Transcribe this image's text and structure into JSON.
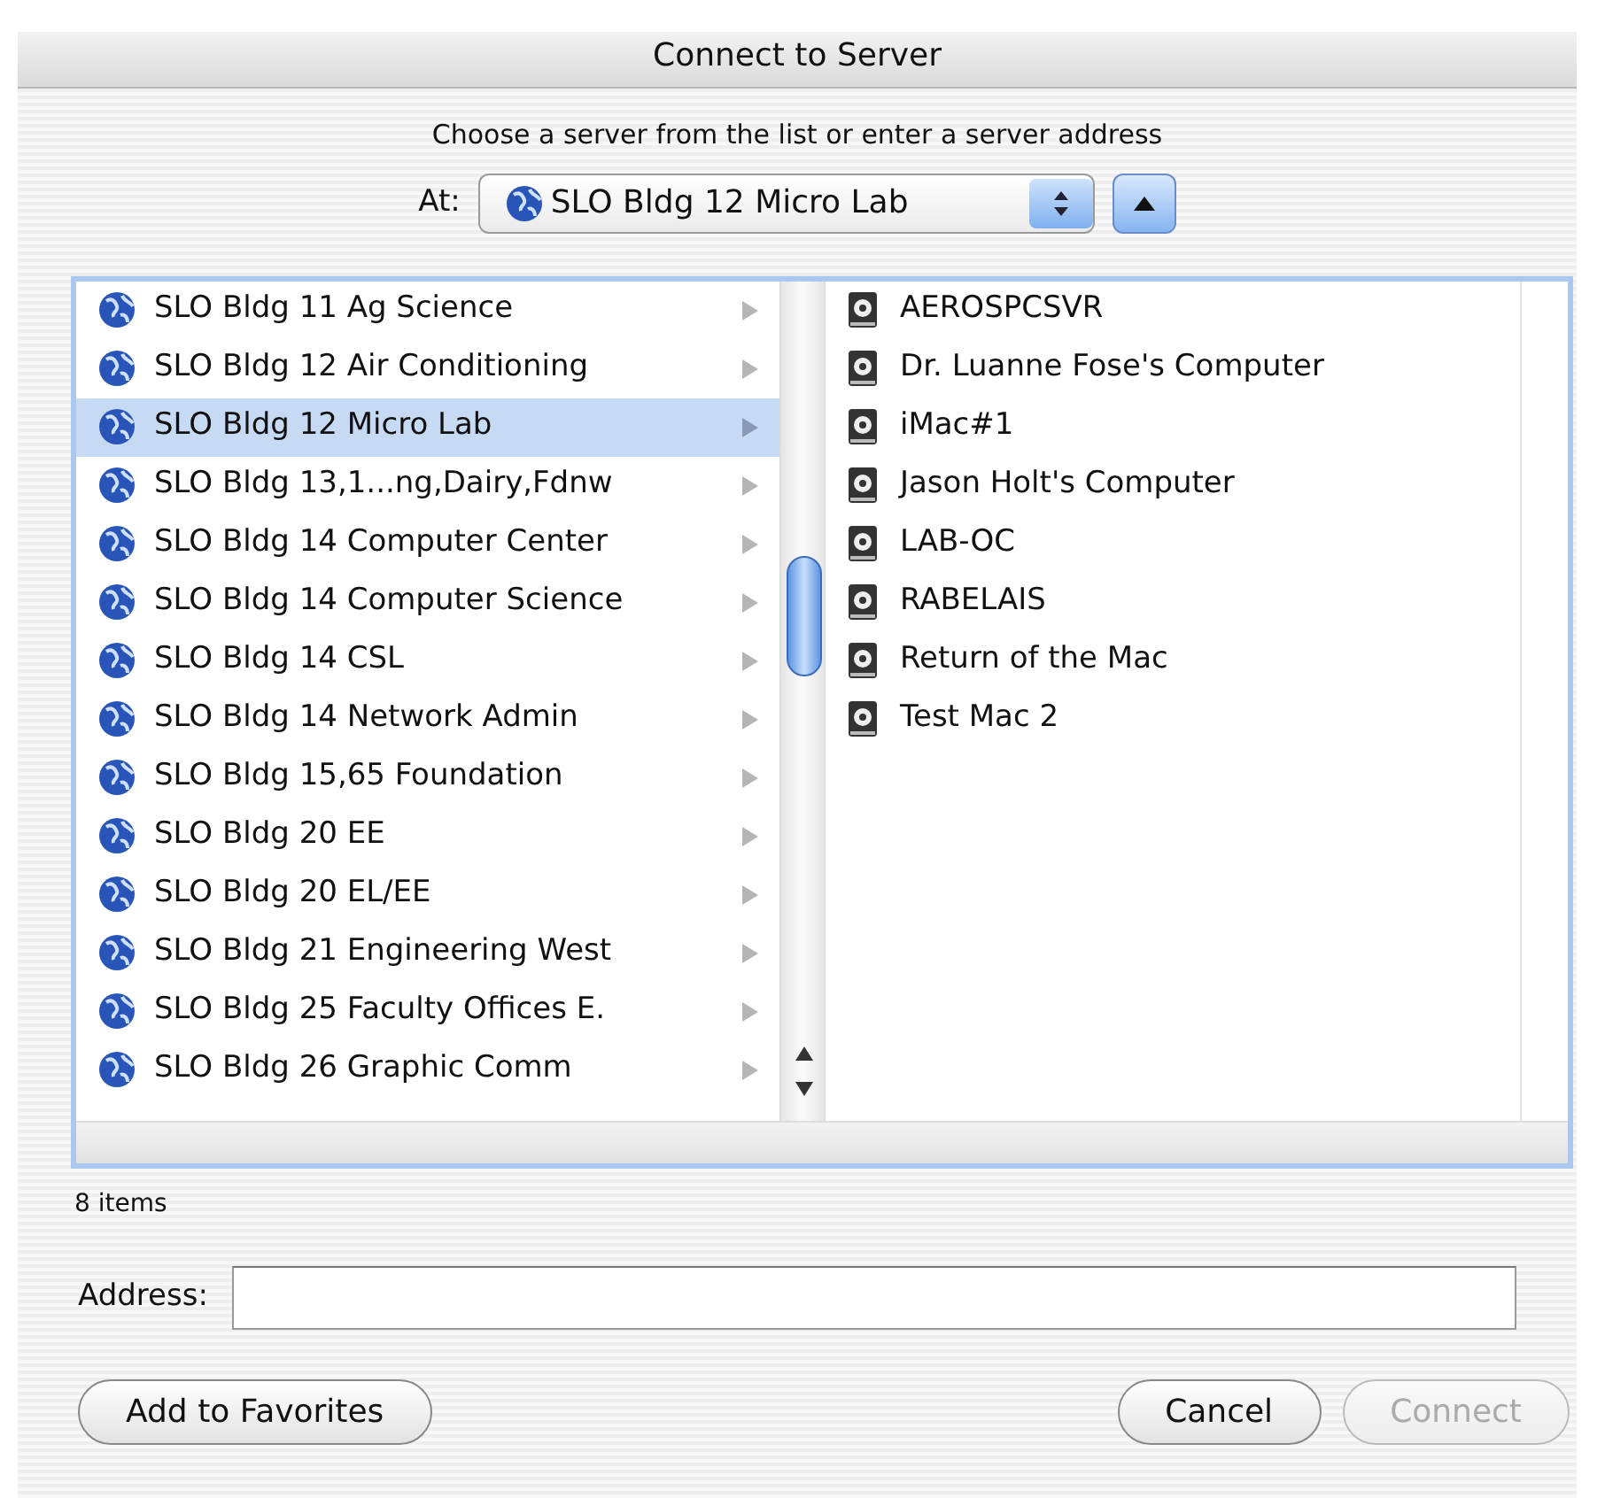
{
  "window": {
    "title": "Connect to Server"
  },
  "prompt": "Choose a server from the list or enter a server address",
  "at": {
    "label": "At:",
    "value": "SLO Bldg 12 Micro Lab"
  },
  "servers": [
    {
      "name": "SLO Bldg 11 Ag Science",
      "selected": false
    },
    {
      "name": "SLO Bldg 12 Air Conditioning",
      "selected": false
    },
    {
      "name": "SLO Bldg 12 Micro Lab",
      "selected": true
    },
    {
      "name": "SLO Bldg 13,1...ng,Dairy,Fdnw",
      "selected": false
    },
    {
      "name": "SLO Bldg 14 Computer Center",
      "selected": false
    },
    {
      "name": "SLO Bldg 14 Computer Science",
      "selected": false
    },
    {
      "name": "SLO Bldg 14 CSL",
      "selected": false
    },
    {
      "name": "SLO Bldg 14 Network Admin",
      "selected": false
    },
    {
      "name": "SLO Bldg 15,65 Foundation",
      "selected": false
    },
    {
      "name": "SLO Bldg 20 EE",
      "selected": false
    },
    {
      "name": "SLO Bldg 20 EL/EE",
      "selected": false
    },
    {
      "name": "SLO Bldg 21 Engineering West",
      "selected": false
    },
    {
      "name": "SLO Bldg 25 Faculty Offices E.",
      "selected": false
    },
    {
      "name": "SLO Bldg 26 Graphic Comm",
      "selected": false
    }
  ],
  "computers": [
    {
      "name": "AEROSPCSVR"
    },
    {
      "name": "Dr. Luanne Fose's Computer"
    },
    {
      "name": "iMac#1"
    },
    {
      "name": "Jason Holt's Computer"
    },
    {
      "name": "LAB-OC"
    },
    {
      "name": "RABELAIS"
    },
    {
      "name": "Return of the Mac"
    },
    {
      "name": "Test Mac 2"
    }
  ],
  "status": "8 items",
  "address": {
    "label": "Address:"
  },
  "buttons": [
    {
      "label": "Add to Favorites",
      "disabled": false,
      "kind": "left"
    },
    {
      "label": "Cancel",
      "disabled": false,
      "kind": "right"
    },
    {
      "label": "Connect",
      "disabled": true,
      "kind": "right"
    }
  ]
}
